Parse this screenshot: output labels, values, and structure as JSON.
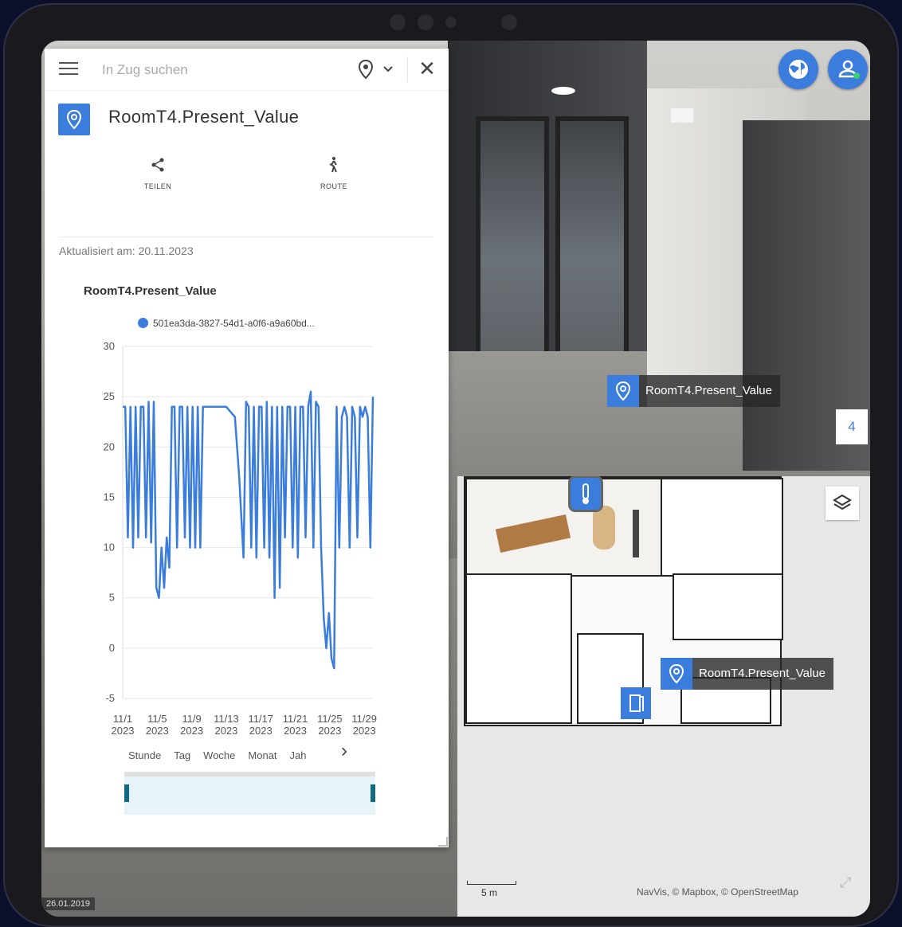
{
  "panel": {
    "search_placeholder": "In Zug suchen",
    "title": "RoomT4.Present_Value",
    "actions": [
      {
        "label": "TEILEN",
        "icon": "share-icon"
      },
      {
        "label": "ROUTE",
        "icon": "walk-icon"
      }
    ],
    "updated": "Aktualisiert am: 20.11.2023",
    "range_tabs": [
      "Stunde",
      "Tag",
      "Woche",
      "Monat",
      "Jah"
    ]
  },
  "chart_data": {
    "type": "line",
    "title": "RoomT4.Present_Value",
    "legend_position": "top",
    "series": [
      {
        "name": "501ea3da-3827-54d1-a0f6-a9a60bd...",
        "color": "#3b7ddd",
        "x": [
          0,
          0.3,
          0.6,
          0.9,
          1.2,
          1.5,
          1.8,
          2.1,
          2.4,
          2.7,
          3.0,
          3.3,
          3.6,
          3.9,
          4.2,
          4.5,
          4.8,
          5.1,
          5.4,
          5.7,
          6.0,
          6.3,
          6.6,
          6.9,
          7.2,
          7.5,
          7.8,
          8.1,
          8.4,
          8.7,
          9.0,
          9.3,
          9.6,
          9.9,
          10.2,
          10.5,
          11.0,
          12.0,
          13.0,
          13.5,
          14.0,
          14.3,
          14.6,
          14.9,
          15.2,
          15.5,
          15.8,
          16.1,
          16.4,
          16.7,
          17.0,
          17.3,
          17.6,
          17.9,
          18.2,
          18.5,
          18.8,
          19.1,
          19.4,
          19.7,
          20.0,
          20.3,
          20.6,
          20.9,
          21.2,
          21.5,
          21.8,
          22.1,
          22.4,
          22.7,
          23.0,
          23.3,
          23.6,
          23.9,
          24.2,
          24.5,
          24.8,
          25.1,
          25.4,
          25.7,
          26.0,
          26.3,
          26.6,
          26.9,
          27.2,
          27.5,
          27.8,
          28.1,
          28.4,
          28.7,
          29.0
        ],
        "values": [
          24,
          24,
          11,
          24,
          10,
          24,
          11,
          24,
          24,
          11,
          24.5,
          10.5,
          24.5,
          6,
          5,
          10,
          6,
          11,
          8,
          24,
          24,
          10,
          24,
          24,
          11,
          24,
          10,
          24,
          10,
          24,
          10,
          24,
          24,
          24,
          24,
          24,
          24,
          24,
          23,
          17,
          9,
          24.5,
          24,
          10,
          24,
          9,
          24,
          24,
          10,
          24.5,
          9,
          24,
          5,
          24,
          6,
          24,
          11,
          24,
          24,
          10,
          24,
          9,
          24,
          24,
          11,
          24,
          25.5,
          10,
          24.5,
          24,
          10,
          3,
          0,
          3.5,
          -1,
          -2,
          24,
          10,
          23,
          24,
          23,
          10,
          24,
          23,
          11,
          24,
          23,
          24,
          23,
          10,
          25
        ],
        "_x_note": "days into November 2023"
      }
    ],
    "categories": [
      "11/1 2023",
      "11/5 2023",
      "11/9 2023",
      "11/13 2023",
      "11/17 2023",
      "11/21 2023",
      "11/25 2023",
      "11/29 2023"
    ],
    "ylim": [
      -5,
      30
    ],
    "yticks": [
      -5,
      0,
      5,
      10,
      15,
      20,
      25,
      30
    ],
    "grid": true
  },
  "scene": {
    "poi_label": "RoomT4.Present_Value",
    "level_number": "4"
  },
  "map": {
    "poi_label": "RoomT4.Present_Value",
    "scale_label": "5 m",
    "attribution": "NavVis, © Mapbox, © OpenStreetMap"
  },
  "date_stamp": "26.01.2019",
  "colors": {
    "accent": "#3b7ddd"
  }
}
